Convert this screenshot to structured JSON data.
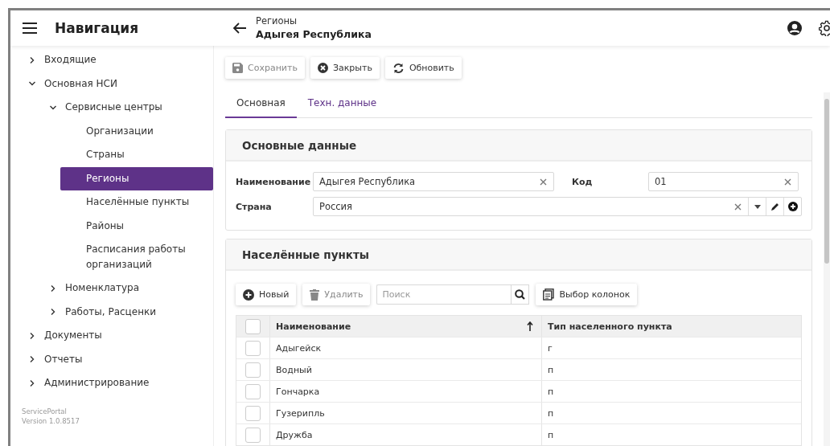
{
  "header": {
    "title": "Навигация",
    "breadcrumb": "Регионы",
    "page_title": "Адыгея Республика"
  },
  "sidebar": {
    "items": [
      {
        "label": "Входящие",
        "expanded": false,
        "selected": false
      },
      {
        "label": "Основная НСИ",
        "expanded": true,
        "selected": false,
        "children": [
          {
            "label": "Сервисные центры",
            "expanded": true,
            "selected": false,
            "children": [
              {
                "label": "Организации",
                "selected": false
              },
              {
                "label": "Страны",
                "selected": false
              },
              {
                "label": "Регионы",
                "selected": true
              },
              {
                "label": "Населённые пункты",
                "selected": false
              },
              {
                "label": "Районы",
                "selected": false
              },
              {
                "label": "Расписания работы организаций",
                "selected": false
              }
            ]
          },
          {
            "label": "Номенклатура",
            "expanded": false,
            "selected": false
          },
          {
            "label": "Работы, Расценки",
            "expanded": false,
            "selected": false
          }
        ]
      },
      {
        "label": "Документы",
        "expanded": false,
        "selected": false
      },
      {
        "label": "Отчеты",
        "expanded": false,
        "selected": false
      },
      {
        "label": "Администрирование",
        "expanded": false,
        "selected": false
      }
    ],
    "footer": [
      "ServicePortal",
      "Version 1.0.8517"
    ]
  },
  "toolbar": [
    {
      "kind": "save",
      "label": "Сохранить",
      "disabled": true
    },
    {
      "kind": "close",
      "label": "Закрыть",
      "disabled": false
    },
    {
      "kind": "refresh",
      "label": "Обновить",
      "disabled": false
    }
  ],
  "tabs": [
    {
      "label": "Основная",
      "selected": true
    },
    {
      "label": "Техн. данные",
      "selected": false
    }
  ],
  "main_panel": {
    "title": "Основные данные",
    "name_label": "Наименование",
    "name_value": "Адыгея Республика",
    "code_label": "Код",
    "code_value": "01",
    "country_label": "Страна",
    "country_value": "Россия"
  },
  "places_panel": {
    "title": "Населённые пункты",
    "toolbar": [
      {
        "kind": "new",
        "label": "Новый",
        "disabled": false
      },
      {
        "kind": "delete",
        "label": "Удалить",
        "disabled": true
      }
    ],
    "search": {
      "placeholder": "Поиск"
    },
    "columns_button": "Выбор колонок",
    "table": {
      "select_all_checked": false,
      "columns": [
        "Наименование",
        "Тип населенного пункта"
      ],
      "rows": [
        {
          "checked": false,
          "cells": [
            "Адыгейск",
            "г"
          ]
        },
        {
          "checked": false,
          "cells": [
            "Водный",
            "п"
          ]
        },
        {
          "checked": false,
          "cells": [
            "Гончарка",
            "п"
          ]
        },
        {
          "checked": false,
          "cells": [
            "Гузерипль",
            "п"
          ]
        },
        {
          "checked": false,
          "cells": [
            "Дружба",
            "п"
          ]
        }
      ]
    }
  }
}
